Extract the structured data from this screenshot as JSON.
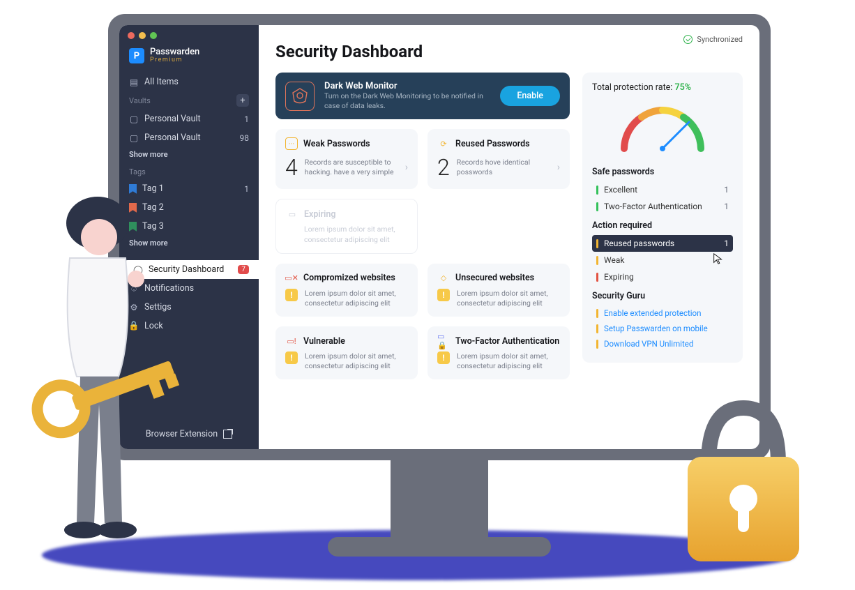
{
  "brand": {
    "name": "Passwarden",
    "tier": "Premium",
    "badge": "P"
  },
  "sync_label": "Synchronized",
  "sidebar": {
    "all_items": "All Items",
    "vaults_header": "Vaults",
    "vaults": [
      {
        "label": "Personal Vault",
        "count": "1"
      },
      {
        "label": "Personal Vault",
        "count": "98"
      }
    ],
    "show_more": "Show more",
    "tags_header": "Tags",
    "tags": [
      {
        "label": "Tag 1",
        "count": "1",
        "color": "#2f7bd6"
      },
      {
        "label": "Tag 2",
        "count": "",
        "color": "#e1694b"
      },
      {
        "label": "Tag 3",
        "count": "",
        "color": "#2f8f5d"
      }
    ],
    "tags_show_more": "Show more",
    "menu": {
      "security": "Security Dashboard",
      "security_badge": "7",
      "notifications": "Notifications",
      "settings": "Settigs",
      "lock": "Lock"
    },
    "footer": "Browser Extension"
  },
  "page_title": "Security Dashboard",
  "hero": {
    "title": "Dark Web Monitor",
    "desc": "Turn on the Dark Web Monitoring to be notified in case of data leaks.",
    "button": "Enable"
  },
  "cards": {
    "weak": {
      "title": "Weak Passwords",
      "count": "4",
      "desc": "Records are susceptible to hacking. have a very simple"
    },
    "reused": {
      "title": "Reused Passwords",
      "count": "2",
      "desc": "Records hove identical posswords"
    },
    "expiring": {
      "title": "Expiring",
      "desc": "Lorem ipsum dolor sit amet, consectetur adipiscing elit"
    },
    "compromised": {
      "title": "Compromized websites",
      "desc": "Lorem ipsum dolor sit amet, consectetur adipiscing elit"
    },
    "unsecured": {
      "title": "Unsecured websites",
      "desc": "Lorem ipsum dolor sit amet, consectetur adipiscing elit"
    },
    "vulnerable": {
      "title": "Vulnerable",
      "desc": "Lorem ipsum dolor sit amet, consectetur adipiscing elit"
    },
    "twofa": {
      "title": "Two-Factor Authentication",
      "desc": "Lorem ipsum dolor sit amet, consectetur adipiscing elit"
    }
  },
  "right": {
    "prot_label": "Total protection rate:",
    "prot_value": "75%",
    "safe_header": "Safe passwords",
    "safe": [
      {
        "label": "Excellent",
        "count": "1",
        "color": "#33c15a"
      },
      {
        "label": "Two-Factor Authentication",
        "count": "1",
        "color": "#33c15a"
      }
    ],
    "action_header": "Action required",
    "action": [
      {
        "label": "Reused passwords",
        "count": "1",
        "color": "#f2b531",
        "selected": true
      },
      {
        "label": "Weak",
        "count": "",
        "color": "#f2b531"
      },
      {
        "label": "Expiring",
        "count": "",
        "color": "#e25241"
      }
    ],
    "guru_header": "Security Guru",
    "guru": [
      {
        "label": "Enable extended protection",
        "color": "#f2b531"
      },
      {
        "label": "Setup Passwarden on mobile",
        "color": "#f2b531"
      },
      {
        "label": "Download VPN Unlimited",
        "color": "#f2b531"
      }
    ]
  },
  "colors": {
    "traffic": [
      "#ed6a5e",
      "#f5bf4f",
      "#61c554"
    ]
  }
}
